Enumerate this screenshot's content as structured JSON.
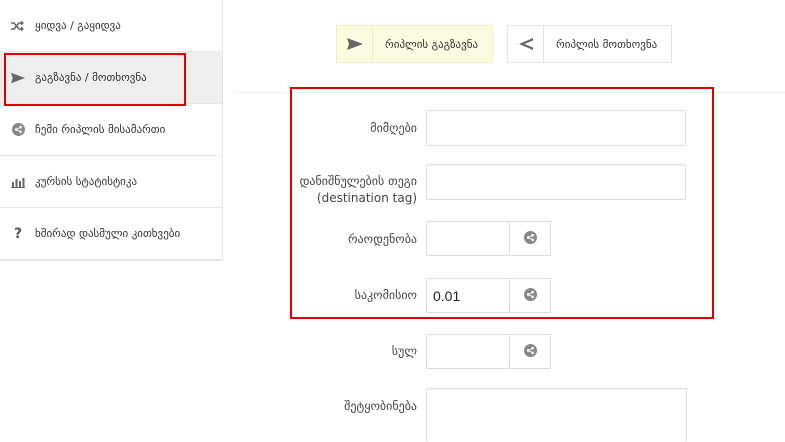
{
  "sidebar": {
    "items": [
      {
        "label": "ყიდვა / გაყიდვა",
        "icon": "shuffle-icon",
        "active": false
      },
      {
        "label": "გაგზავნა / მოთხოვნა",
        "icon": "send-icon",
        "active": true
      },
      {
        "label": "ჩემი რიპლის მისამართი",
        "icon": "share-icon",
        "active": false
      },
      {
        "label": "კურსის სტატისტიკა",
        "icon": "bar-chart-icon",
        "active": false
      },
      {
        "label": "ხშირად დასმული კითხვები",
        "icon": "question-icon",
        "active": false
      }
    ]
  },
  "tabs": {
    "send_label": "რიპლის გაგზავნა",
    "request_label": "რიპლის მოთხოვნა"
  },
  "form": {
    "recipient_label": "მიმღები",
    "recipient_value": "",
    "destination_tag_label": "დანიშნულების თეგი",
    "destination_tag_sub": "(destination tag)",
    "destination_tag_value": "",
    "amount_label": "რაოდენობა",
    "amount_value": "",
    "fee_label": "საკომისიო",
    "fee_value": "0.01",
    "total_label": "სულ",
    "total_value": "",
    "message_label": "შეტყობინება",
    "message_value": ""
  },
  "colors": {
    "highlight": "#e00000",
    "active_tab_bg": "#fbfbe0",
    "sidebar_active_bg": "#eeeeee",
    "icon": "#666666"
  }
}
